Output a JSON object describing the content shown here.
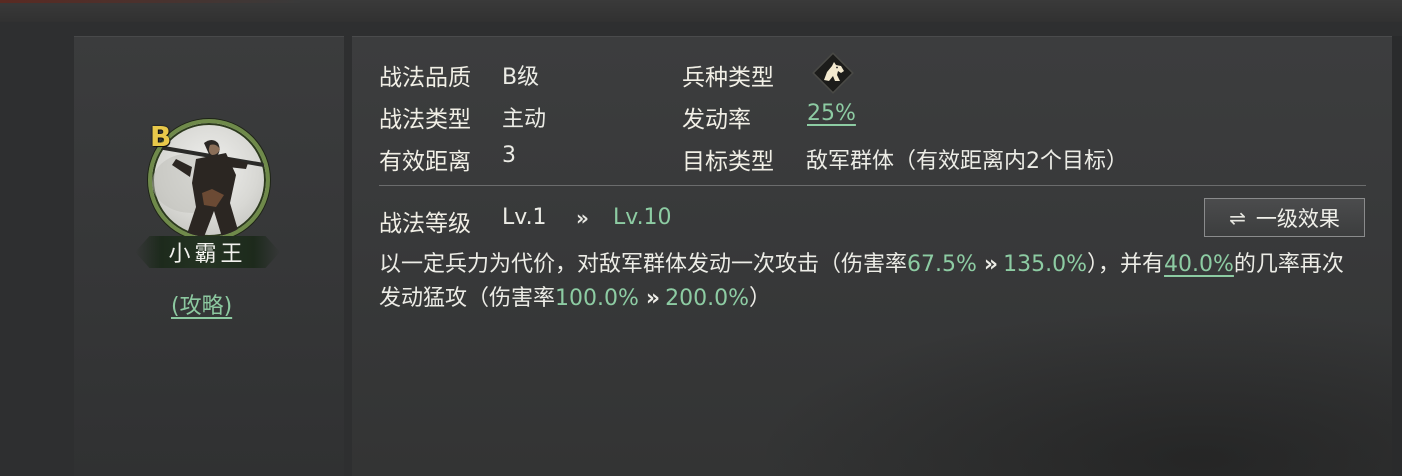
{
  "hero": {
    "grade": "B",
    "name": "小霸王",
    "guide_link": "(攻略)"
  },
  "tactic": {
    "quality_label": "战法品质",
    "quality_value": "B级",
    "type_label": "战法类型",
    "type_value": "主动",
    "range_label": "有效距离",
    "range_value": "3",
    "unit_type_label": "兵种类型",
    "unit_type_icon": "cavalry-horse-icon",
    "trigger_label": "发动率",
    "trigger_value": "25%",
    "target_label": "目标类型",
    "target_value": "敌军群体（有效距离内2个目标）",
    "level_label": "战法等级",
    "level_from": "Lv.1",
    "level_arrow": "»",
    "level_to": "Lv.10",
    "effect_button_label": "一级效果",
    "effect_button_icon": "swap-arrows-icon"
  },
  "description": {
    "p1": "以一定兵力为代价，对敌军群体发动一次攻击（伤害率",
    "dmg1_from": "67.5%",
    "arrow1": "»",
    "dmg1_to": "135.0%",
    "p2": "），并有",
    "chance": "40.0%",
    "p3": "的几率再次发动猛攻（伤害率",
    "dmg2_from": "100.0%",
    "arrow2": "»",
    "dmg2_to": "200.0%",
    "p4": "）"
  },
  "colors": {
    "accent_green": "#8dcca3",
    "grade_gold": "#e8c84a",
    "portrait_ring": "#6f8a4a"
  }
}
